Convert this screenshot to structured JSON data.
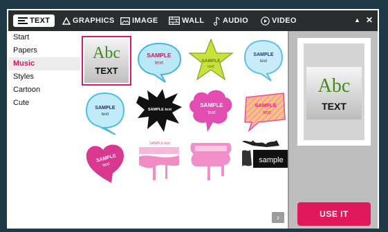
{
  "tabs": [
    {
      "label": "TEXT",
      "icon": "text-lines-icon",
      "active": true
    },
    {
      "label": "GRAPHICS",
      "icon": "triangle-icon"
    },
    {
      "label": "IMAGE",
      "icon": "image-icon"
    },
    {
      "label": "WALL",
      "icon": "wall-icon"
    },
    {
      "label": "AUDIO",
      "icon": "music-note-icon"
    },
    {
      "label": "VIDEO",
      "icon": "play-circle-icon"
    }
  ],
  "window_buttons": {
    "minimize": "▲",
    "close": "✕"
  },
  "sidebar": {
    "items": [
      {
        "label": "Start"
      },
      {
        "label": "Papers"
      },
      {
        "label": "Music",
        "selected": true
      },
      {
        "label": "Styles"
      },
      {
        "label": "Cartoon"
      },
      {
        "label": "Cute"
      }
    ]
  },
  "grid": {
    "abc": "Abc",
    "text_word": "TEXT",
    "sample": "SAMPLE",
    "text": "text",
    "sample_text": "SAMPLE text",
    "sample_lower": "sample"
  },
  "preview": {
    "abc": "Abc",
    "text_word": "TEXT"
  },
  "use_button": "USE IT",
  "next_button": "›",
  "colors": {
    "accent": "#e0195c",
    "selected_text": "#d6175c",
    "green_abc": "#3f8b1b"
  }
}
